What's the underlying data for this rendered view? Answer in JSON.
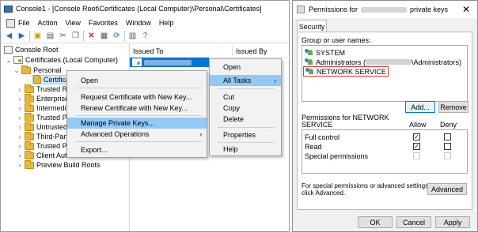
{
  "mmc": {
    "title": "Console1 - [Console Root\\Certificates (Local Computer)\\Personal\\Certificates]",
    "menu": [
      "File",
      "Action",
      "View",
      "Favorites",
      "Window",
      "Help"
    ],
    "tree": {
      "root": "Console Root",
      "certs": "Certificates (Local Computer)",
      "personal": "Personal",
      "certificates": "Certifica",
      "items": [
        "Trusted Roo",
        "Enterprise T",
        "Intermediat",
        "Trusted Pub",
        "Untrusted C",
        "Third-Party",
        "Trusted Peo",
        "Client Authe",
        "Preview Build Roots"
      ]
    },
    "list": {
      "col_issued_to": "Issued To",
      "col_issued_by": "Issued By"
    },
    "context_menu": {
      "items": [
        "Open",
        "Request Certificate with New Key...",
        "Renew Certificate with New Key...",
        "Manage Private Keys...",
        "Advanced Operations",
        "Export..."
      ]
    },
    "action_menu": {
      "items": [
        "Open",
        "All Tasks",
        "Cut",
        "Copy",
        "Delete",
        "Properties",
        "Help"
      ]
    }
  },
  "dialog": {
    "title_prefix": "Permissions for",
    "title_suffix": "private keys",
    "close": "✕",
    "tab": "Security",
    "group_label": "Group or user names:",
    "users": [
      {
        "name": "SYSTEM"
      },
      {
        "name_prefix": "Administrators (",
        "name_suffix": "\\Administrators)"
      },
      {
        "name": "NETWORK SERVICE"
      }
    ],
    "add_button": "Add...",
    "remove_button": "Remove",
    "perm_label_line1": "Permissions for NETWORK",
    "perm_label_line2": "SERVICE",
    "col_allow": "Allow",
    "col_deny": "Deny",
    "permissions": [
      {
        "name": "Full control",
        "allow": "✓",
        "deny": ""
      },
      {
        "name": "Read",
        "allow": "✓",
        "deny": ""
      },
      {
        "name": "Special permissions",
        "allow": "",
        "deny": ""
      }
    ],
    "advanced_text_line1": "For special permissions or advanced settings,",
    "advanced_text_line2": "click Advanced.",
    "advanced_button": "Advanced",
    "ok_button": "OK",
    "cancel_button": "Cancel",
    "apply_button": "Apply"
  }
}
